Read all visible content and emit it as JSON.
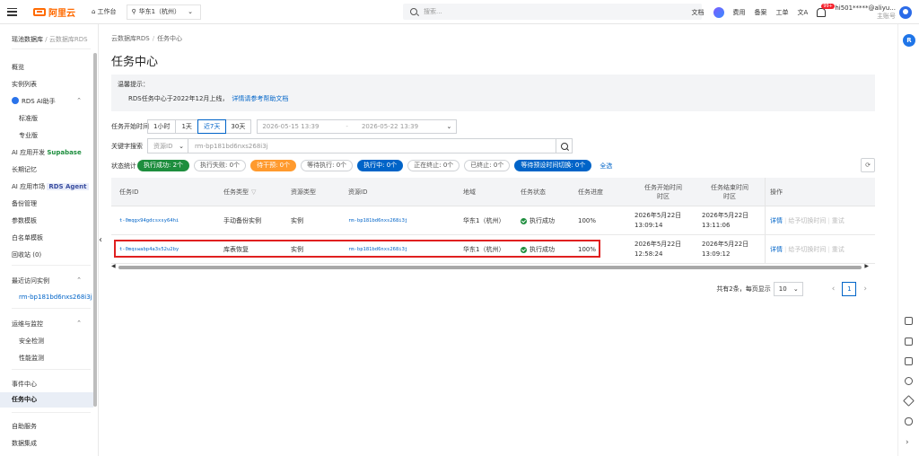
{
  "topbar": {
    "logo": "阿里云",
    "workbench": "工作台",
    "region": "华东1（杭州）",
    "search_placeholder": "搜索...",
    "links": [
      "文档",
      "费用",
      "备案",
      "工单"
    ],
    "badge": "99+",
    "account_name": "hi501*****@aliyu...",
    "account_sub": "主账号"
  },
  "sidebar": {
    "crumb_home": "瑶池数据库",
    "crumb_sep": "/",
    "crumb_rds": "云数据库RDS",
    "items": [
      "概览",
      "实例列表",
      "RDS AI助手",
      "标准版",
      "专业版",
      "AI 应用开发",
      "Supabase",
      "长期记忆",
      "AI 应用市场",
      "RDS Agent",
      "备份管理",
      "参数模板",
      "白名单模板",
      "回收站 (0)",
      "最近访问实例",
      "rm-bp181bd6nxs268i3j",
      "运维与监控",
      "安全检测",
      "性能监测",
      "事件中心",
      "任务中心",
      "自助服务",
      "数据集成"
    ]
  },
  "main": {
    "crumb": [
      "云数据库RDS",
      "任务中心"
    ],
    "title": "任务中心",
    "notice_title": "温馨提示：",
    "notice_text": "RDS任务中心于2022年12月上线，",
    "notice_link": "详情请参考帮助文档",
    "time_label": "任务开始时间",
    "time_options": [
      "1小时",
      "1天",
      "近7天",
      "30天"
    ],
    "time_selected": "近7天",
    "time_start": "2026-05-15 13:39",
    "time_end": "2026-05-22 13:39",
    "keyword_label": "关键字搜索",
    "keyword_type": "资源ID",
    "keyword_value": "rm-bp181bd6nxs268i3j",
    "status_label": "状态统计",
    "status_pills": [
      "执行成功: 2个",
      "执行失败: 0个",
      "待干预: 0个",
      "等待执行: 0个",
      "执行中: 0个",
      "正在终止: 0个",
      "已终止: 0个",
      "等待预设时间切换: 0个"
    ],
    "all_link": "全选"
  },
  "table": {
    "headers": [
      "任务ID",
      "任务类型",
      "资源类型",
      "资源ID",
      "地域",
      "任务状态",
      "任务进度",
      "任务开始时间\n时区",
      "任务结束时间\n时区",
      "操作"
    ],
    "rows": [
      {
        "task_id": "t-0mqgx94gdcsxsy64hi",
        "type": "手动备份实例",
        "resource_type": "实例",
        "resource_id": "rm-bp181bd6nxs268i3j",
        "region": "华东1（杭州）",
        "status": "执行成功",
        "progress": "100%",
        "start_date": "2026年5月22日",
        "start_time": "13:09:14",
        "end_date": "2026年5月22日",
        "end_time": "13:11:06",
        "op_detail": "详情",
        "op_switch": "给予切换时间",
        "op_retry": "重试"
      },
      {
        "task_id": "t-0mqswabp4a3s52u2by",
        "type": "库表恢复",
        "resource_type": "实例",
        "resource_id": "rm-bp181bd6nxs268i3j",
        "region": "华东1（杭州）",
        "status": "执行成功",
        "progress": "100%",
        "start_date": "2026年5月22日",
        "start_time": "12:58:24",
        "end_date": "2026年5月22日",
        "end_time": "13:09:12",
        "op_detail": "详情",
        "op_switch": "给予切换时间",
        "op_retry": "重试"
      }
    ]
  },
  "pager": {
    "summary": "共有2条，每页显示",
    "page_size": "10",
    "current_page": "1"
  },
  "colors": {
    "primary": "#0064c8",
    "success": "#1e8e3e",
    "warning": "#ff9a2e",
    "brand": "#ff6a00",
    "highlight": "#e02020"
  }
}
